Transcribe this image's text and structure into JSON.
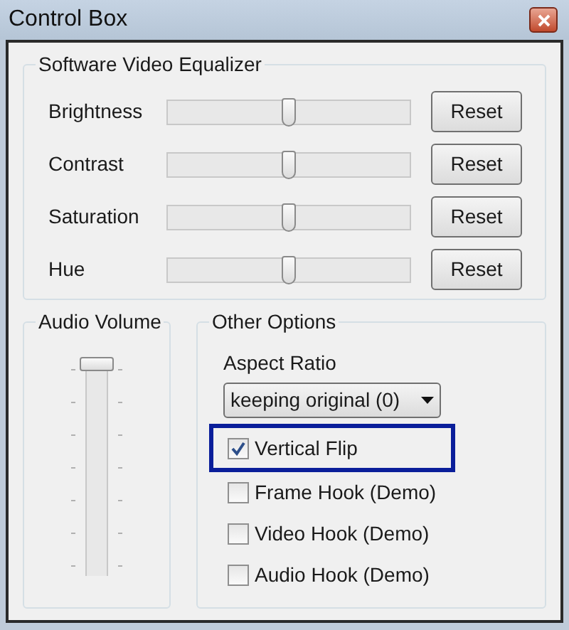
{
  "window": {
    "title": "Control Box"
  },
  "equalizer": {
    "title": "Software Video Equalizer",
    "rows": [
      {
        "label": "Brightness",
        "level": 0.5,
        "button": "Reset"
      },
      {
        "label": "Contrast",
        "level": 0.5,
        "button": "Reset"
      },
      {
        "label": "Saturation",
        "level": 0.5,
        "button": "Reset"
      },
      {
        "label": "Hue",
        "level": 0.5,
        "button": "Reset"
      }
    ]
  },
  "audio": {
    "title": "Audio Volume",
    "level": 1
  },
  "other": {
    "title": "Other Options",
    "aspect_label": "Aspect Ratio",
    "aspect_value": "keeping original (0)",
    "options": [
      {
        "label": "Vertical Flip",
        "checked": true,
        "highlighted": true
      },
      {
        "label": "Frame Hook (Demo)",
        "checked": false,
        "highlighted": false
      },
      {
        "label": "Video Hook (Demo)",
        "checked": false,
        "highlighted": false
      },
      {
        "label": "Audio Hook (Demo)",
        "checked": false,
        "highlighted": false
      }
    ]
  }
}
